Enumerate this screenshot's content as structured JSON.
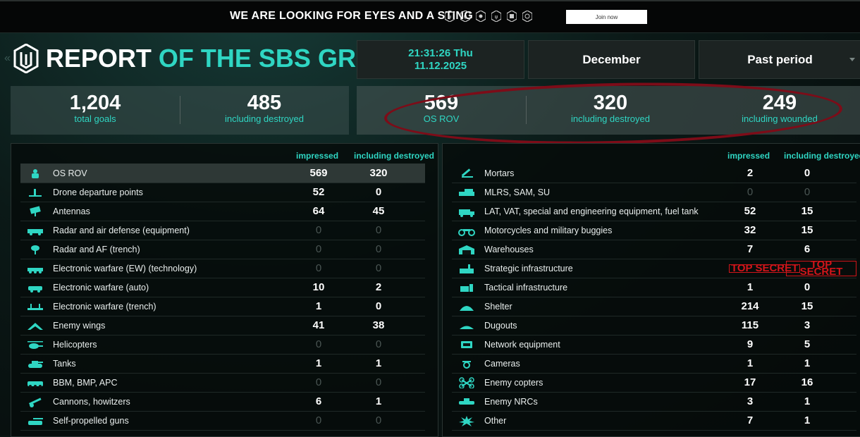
{
  "topbar": {
    "slogan": "WE ARE LOOKING FOR EYES AND A STING",
    "badges": [
      "unit-badge-icon",
      "unit-badge-icon",
      "unit-badge-icon",
      "unit-badge-icon",
      "unit-badge-icon",
      "unit-badge-icon"
    ],
    "join_label": "Join now"
  },
  "header": {
    "title_white": "REPORT",
    "title_green": " OF THE SBS GROUP",
    "time_line": "21:31:26 Thu",
    "date_line": "11.12.2025",
    "month": "December",
    "period": "Past period"
  },
  "stats_left": [
    {
      "num": "1,204",
      "label": "total goals"
    },
    {
      "num": "485",
      "label": "including destroyed"
    }
  ],
  "stats_right": [
    {
      "num": "569",
      "label": "OS ROV"
    },
    {
      "num": "320",
      "label": "including destroyed"
    },
    {
      "num": "249",
      "label": "including wounded"
    }
  ],
  "table_left": {
    "col1": "impressed",
    "col2": "including destroyed",
    "rows": [
      {
        "name": "OS ROV",
        "a": "569",
        "b": "320",
        "icon": "soldier-icon"
      },
      {
        "name": "Drone departure points",
        "a": "52",
        "b": "0",
        "icon": "launch-point-icon"
      },
      {
        "name": "Antennas",
        "a": "64",
        "b": "45",
        "icon": "antenna-icon"
      },
      {
        "name": "Radar and air defense (equipment)",
        "a": "0",
        "b": "0",
        "icon": "radar-vehicle-icon"
      },
      {
        "name": "Radar and AF (trench)",
        "a": "0",
        "b": "0",
        "icon": "radar-trench-icon"
      },
      {
        "name": "Electronic warfare (EW) (technology)",
        "a": "0",
        "b": "0",
        "icon": "ew-tech-icon"
      },
      {
        "name": "Electronic warfare (auto)",
        "a": "10",
        "b": "2",
        "icon": "ew-auto-icon"
      },
      {
        "name": "Electronic warfare (trench)",
        "a": "1",
        "b": "0",
        "icon": "ew-trench-icon"
      },
      {
        "name": "Enemy wings",
        "a": "41",
        "b": "38",
        "icon": "wing-icon"
      },
      {
        "name": "Helicopters",
        "a": "0",
        "b": "0",
        "icon": "helicopter-icon"
      },
      {
        "name": "Tanks",
        "a": "1",
        "b": "1",
        "icon": "tank-icon"
      },
      {
        "name": "BBM, BMP, APC",
        "a": "0",
        "b": "0",
        "icon": "apc-icon"
      },
      {
        "name": "Cannons, howitzers",
        "a": "6",
        "b": "1",
        "icon": "cannon-icon"
      },
      {
        "name": "Self-propelled guns",
        "a": "0",
        "b": "0",
        "icon": "spg-icon"
      }
    ]
  },
  "table_right": {
    "col1": "impressed",
    "col2": "including destroyed",
    "rows": [
      {
        "name": "Mortars",
        "a": "2",
        "b": "0",
        "icon": "mortar-icon"
      },
      {
        "name": "MLRS, SAM, SU",
        "a": "0",
        "b": "0",
        "icon": "mlrs-icon"
      },
      {
        "name": "LAT, VAT, special and engineering equipment, fuel tank",
        "a": "52",
        "b": "15",
        "icon": "truck-icon"
      },
      {
        "name": "Motorcycles and military buggies",
        "a": "32",
        "b": "15",
        "icon": "motorcycle-icon"
      },
      {
        "name": "Warehouses",
        "a": "7",
        "b": "6",
        "icon": "warehouse-icon"
      },
      {
        "name": "Strategic infrastructure",
        "a": "TOP SECRET",
        "b": "TOP SECRET",
        "icon": "factory-icon"
      },
      {
        "name": "Tactical infrastructure",
        "a": "1",
        "b": "0",
        "icon": "tactical-icon"
      },
      {
        "name": "Shelter",
        "a": "214",
        "b": "15",
        "icon": "shelter-icon"
      },
      {
        "name": "Dugouts",
        "a": "115",
        "b": "3",
        "icon": "dugout-icon"
      },
      {
        "name": "Network equipment",
        "a": "9",
        "b": "5",
        "icon": "network-icon"
      },
      {
        "name": "Cameras",
        "a": "1",
        "b": "1",
        "icon": "camera-icon"
      },
      {
        "name": "Enemy copters",
        "a": "17",
        "b": "16",
        "icon": "drone-icon"
      },
      {
        "name": "Enemy NRCs",
        "a": "3",
        "b": "1",
        "icon": "ugv-icon"
      },
      {
        "name": "Other",
        "a": "7",
        "b": "1",
        "icon": "explosion-icon"
      }
    ]
  },
  "colors": {
    "accent": "#2fd6c3",
    "highlight": "#7d0c18",
    "secret": "#d3151a"
  }
}
